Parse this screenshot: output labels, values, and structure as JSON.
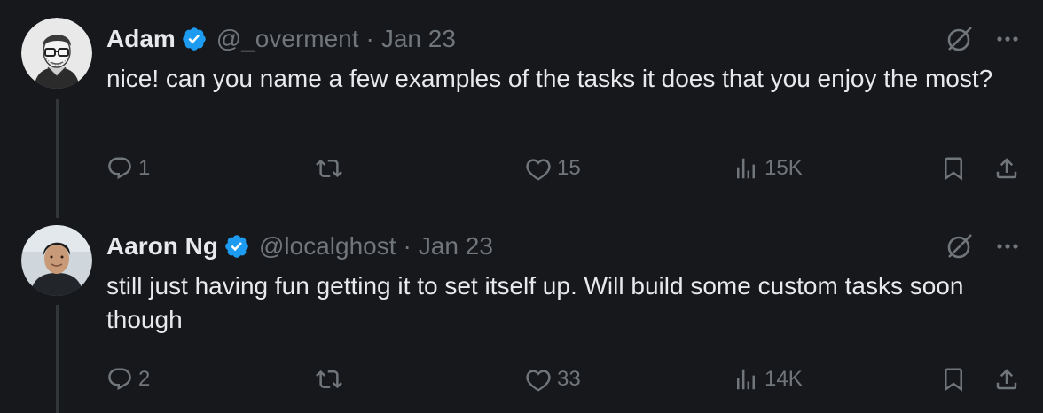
{
  "tweets": [
    {
      "name": "Adam",
      "handle": "@_overment",
      "separator": "·",
      "date": "Jan 23",
      "text": "nice! can you name a few examples of the tasks it does that you enjoy the most?",
      "replies": "1",
      "retweets": "",
      "likes": "15",
      "views": "15K",
      "avatar_icon": "avatar-illustrated-man-glasses"
    },
    {
      "name": "Aaron Ng",
      "handle": "@localghost",
      "separator": "·",
      "date": "Jan 23",
      "text": "still just having fun getting it to set itself up. Will build some custom tasks soon though",
      "replies": "2",
      "retweets": "",
      "likes": "33",
      "views": "14K",
      "avatar_icon": "avatar-photo-man"
    }
  ],
  "colors": {
    "background": "#16181c",
    "text_primary": "#e7e9ea",
    "text_secondary": "#71767b",
    "verified_blue": "#1d9bf0",
    "thread_line": "#333639"
  },
  "icons": [
    "verified-badge-icon",
    "grok-icon",
    "more-icon",
    "reply-icon",
    "retweet-icon",
    "like-icon",
    "views-icon",
    "bookmark-icon",
    "share-icon"
  ]
}
